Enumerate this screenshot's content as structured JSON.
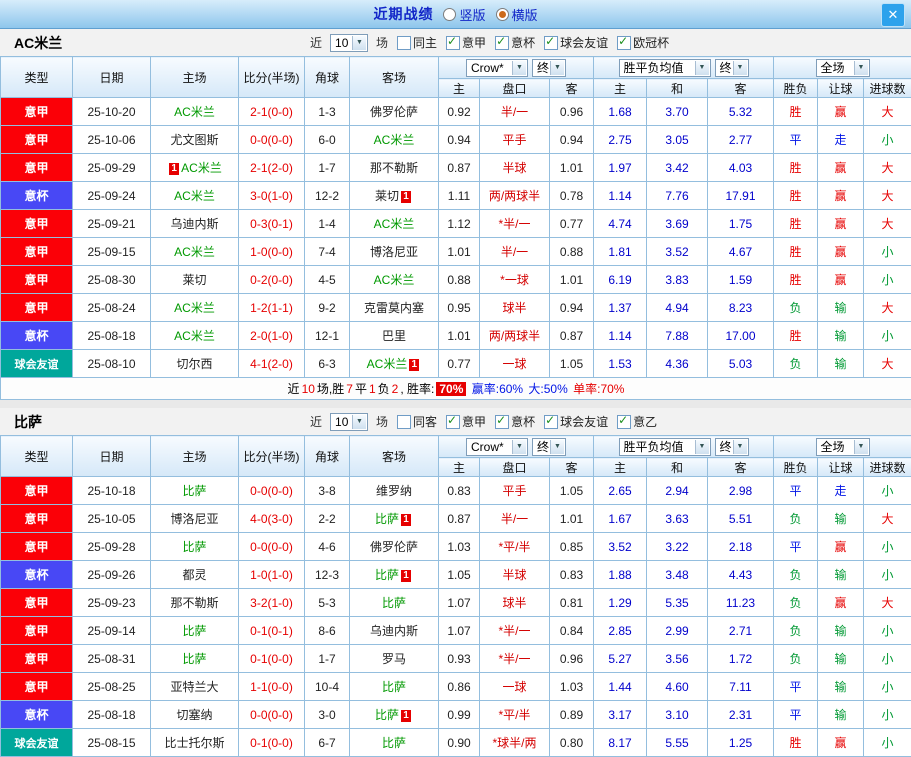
{
  "titlebar": {
    "title": "近期战绩",
    "vertical": "竖版",
    "horizontal": "横版",
    "close": "✕"
  },
  "sections": [
    {
      "team": "AC米兰",
      "filters": {
        "near": "近",
        "count": "10",
        "games": "场",
        "checkboxes": [
          {
            "label": "同主",
            "checked": false
          },
          {
            "label": "意甲",
            "checked": true
          },
          {
            "label": "意杯",
            "checked": true
          },
          {
            "label": "球会友谊",
            "checked": true
          },
          {
            "label": "欧冠杯",
            "checked": true
          }
        ]
      },
      "dropdowns": {
        "company": "Crow*",
        "final1": "终",
        "avg": "胜平负均值",
        "final2": "终",
        "scope": "全场"
      },
      "columns": {
        "type": "类型",
        "date": "日期",
        "home": "主场",
        "score": "比分(半场)",
        "corners": "角球",
        "away": "客场",
        "odds_home": "主",
        "handicap": "盘口",
        "odds_away": "客",
        "avg_home": "主",
        "avg_draw": "和",
        "avg_away": "客",
        "result": "胜负",
        "let": "让球",
        "goals": "进球数"
      },
      "rows": [
        {
          "type": "意甲",
          "date": "25-10-20",
          "home": "AC米兰",
          "home_team": true,
          "score": "2-1(0-0)",
          "corners": "1-3",
          "away": "佛罗伦萨",
          "oh": "0.92",
          "hcap": "半/一",
          "oa": "0.96",
          "ah": "1.68",
          "ad": "3.70",
          "aa": "5.32",
          "res": "胜",
          "let": "赢",
          "goals": "大"
        },
        {
          "type": "意甲",
          "date": "25-10-06",
          "home": "尤文图斯",
          "away": "AC米兰",
          "away_team": true,
          "score": "0-0(0-0)",
          "corners": "6-0",
          "oh": "0.94",
          "hcap": "平手",
          "oa": "0.94",
          "ah": "2.75",
          "ad": "3.05",
          "aa": "2.77",
          "res": "平",
          "let": "走",
          "goals": "小"
        },
        {
          "type": "意甲",
          "date": "25-09-29",
          "home": "AC米兰",
          "home_team": true,
          "home_card": true,
          "score": "2-1(2-0)",
          "corners": "1-7",
          "away": "那不勒斯",
          "oh": "0.87",
          "hcap": "半球",
          "oa": "1.01",
          "ah": "1.97",
          "ad": "3.42",
          "aa": "4.03",
          "res": "胜",
          "let": "赢",
          "goals": "大"
        },
        {
          "type": "意杯",
          "date": "25-09-24",
          "home": "AC米兰",
          "home_team": true,
          "score": "3-0(1-0)",
          "corners": "12-2",
          "away": "莱切",
          "away_card": true,
          "oh": "1.11",
          "hcap": "两/两球半",
          "oa": "0.78",
          "ah": "1.14",
          "ad": "7.76",
          "aa": "17.91",
          "res": "胜",
          "let": "赢",
          "goals": "大"
        },
        {
          "type": "意甲",
          "date": "25-09-21",
          "home": "乌迪内斯",
          "away": "AC米兰",
          "away_team": true,
          "score": "0-3(0-1)",
          "corners": "1-4",
          "oh": "1.12",
          "hcap": "*半/一",
          "oa": "0.77",
          "ah": "4.74",
          "ad": "3.69",
          "aa": "1.75",
          "res": "胜",
          "let": "赢",
          "goals": "大"
        },
        {
          "type": "意甲",
          "date": "25-09-15",
          "home": "AC米兰",
          "home_team": true,
          "score": "1-0(0-0)",
          "corners": "7-4",
          "away": "博洛尼亚",
          "oh": "1.01",
          "hcap": "半/一",
          "oa": "0.88",
          "ah": "1.81",
          "ad": "3.52",
          "aa": "4.67",
          "res": "胜",
          "let": "赢",
          "goals": "小"
        },
        {
          "type": "意甲",
          "date": "25-08-30",
          "home": "莱切",
          "away": "AC米兰",
          "away_team": true,
          "score": "0-2(0-0)",
          "corners": "4-5",
          "oh": "0.88",
          "hcap": "*一球",
          "oa": "1.01",
          "ah": "6.19",
          "ad": "3.83",
          "aa": "1.59",
          "res": "胜",
          "let": "赢",
          "goals": "小"
        },
        {
          "type": "意甲",
          "date": "25-08-24",
          "home": "AC米兰",
          "home_team": true,
          "score": "1-2(1-1)",
          "corners": "9-2",
          "away": "克雷莫内塞",
          "oh": "0.95",
          "hcap": "球半",
          "oa": "0.94",
          "ah": "1.37",
          "ad": "4.94",
          "aa": "8.23",
          "res": "负",
          "let": "输",
          "goals": "大"
        },
        {
          "type": "意杯",
          "date": "25-08-18",
          "home": "AC米兰",
          "home_team": true,
          "score": "2-0(1-0)",
          "corners": "12-1",
          "away": "巴里",
          "oh": "1.01",
          "hcap": "两/两球半",
          "oa": "0.87",
          "ah": "1.14",
          "ad": "7.88",
          "aa": "17.00",
          "res": "胜",
          "let": "输",
          "goals": "小"
        },
        {
          "type": "球会友谊",
          "date": "25-08-10",
          "home": "切尔西",
          "away": "AC米兰",
          "away_team": true,
          "away_card": true,
          "score": "4-1(2-0)",
          "corners": "6-3",
          "oh": "0.77",
          "hcap": "一球",
          "oa": "1.05",
          "ah": "1.53",
          "ad": "4.36",
          "aa": "5.03",
          "res": "负",
          "let": "输",
          "goals": "大"
        }
      ],
      "summary": [
        {
          "t": "近",
          "c": "k"
        },
        {
          "t": "10",
          "c": "r"
        },
        {
          "t": "场,胜",
          "c": "k"
        },
        {
          "t": "7",
          "c": "r"
        },
        {
          "t": "平",
          "c": "k"
        },
        {
          "t": "1",
          "c": "r"
        },
        {
          "t": "负",
          "c": "k"
        },
        {
          "t": "2",
          "c": "r"
        },
        {
          "t": ", 胜率:",
          "c": "k"
        },
        {
          "t": "70%",
          "c": "badge"
        },
        {
          "t": " 赢率:60%",
          "c": "b"
        },
        {
          "t": " 大:50%",
          "c": "b"
        },
        {
          "t": " 单率:70%",
          "c": "r"
        }
      ]
    },
    {
      "team": "比萨",
      "filters": {
        "near": "近",
        "count": "10",
        "games": "场",
        "checkboxes": [
          {
            "label": "同客",
            "checked": false
          },
          {
            "label": "意甲",
            "checked": true
          },
          {
            "label": "意杯",
            "checked": true
          },
          {
            "label": "球会友谊",
            "checked": true
          },
          {
            "label": "意乙",
            "checked": true
          }
        ]
      },
      "dropdowns": {
        "company": "Crow*",
        "final1": "终",
        "avg": "胜平负均值",
        "final2": "终",
        "scope": "全场"
      },
      "columns": {
        "type": "类型",
        "date": "日期",
        "home": "主场",
        "score": "比分(半场)",
        "corners": "角球",
        "away": "客场",
        "odds_home": "主",
        "handicap": "盘口",
        "odds_away": "客",
        "avg_home": "主",
        "avg_draw": "和",
        "avg_away": "客",
        "result": "胜负",
        "let": "让球",
        "goals": "进球数"
      },
      "rows": [
        {
          "type": "意甲",
          "date": "25-10-18",
          "home": "比萨",
          "home_team": true,
          "score": "0-0(0-0)",
          "corners": "3-8",
          "away": "维罗纳",
          "oh": "0.83",
          "hcap": "平手",
          "oa": "1.05",
          "ah": "2.65",
          "ad": "2.94",
          "aa": "2.98",
          "res": "平",
          "let": "走",
          "goals": "小"
        },
        {
          "type": "意甲",
          "date": "25-10-05",
          "home": "博洛尼亚",
          "away": "比萨",
          "away_team": true,
          "away_card": true,
          "score": "4-0(3-0)",
          "corners": "2-2",
          "oh": "0.87",
          "hcap": "半/一",
          "oa": "1.01",
          "ah": "1.67",
          "ad": "3.63",
          "aa": "5.51",
          "res": "负",
          "let": "输",
          "goals": "大"
        },
        {
          "type": "意甲",
          "date": "25-09-28",
          "home": "比萨",
          "home_team": true,
          "score": "0-0(0-0)",
          "corners": "4-6",
          "away": "佛罗伦萨",
          "oh": "1.03",
          "hcap": "*平/半",
          "oa": "0.85",
          "ah": "3.52",
          "ad": "3.22",
          "aa": "2.18",
          "res": "平",
          "let": "赢",
          "goals": "小"
        },
        {
          "type": "意杯",
          "date": "25-09-26",
          "home": "都灵",
          "away": "比萨",
          "away_team": true,
          "away_card": true,
          "score": "1-0(1-0)",
          "corners": "12-3",
          "oh": "1.05",
          "hcap": "半球",
          "oa": "0.83",
          "ah": "1.88",
          "ad": "3.48",
          "aa": "4.43",
          "res": "负",
          "let": "输",
          "goals": "小"
        },
        {
          "type": "意甲",
          "date": "25-09-23",
          "home": "那不勒斯",
          "away": "比萨",
          "away_team": true,
          "score": "3-2(1-0)",
          "corners": "5-3",
          "oh": "1.07",
          "hcap": "球半",
          "oa": "0.81",
          "ah": "1.29",
          "ad": "5.35",
          "aa": "11.23",
          "res": "负",
          "let": "赢",
          "goals": "大"
        },
        {
          "type": "意甲",
          "date": "25-09-14",
          "home": "比萨",
          "home_team": true,
          "score": "0-1(0-1)",
          "corners": "8-6",
          "away": "乌迪内斯",
          "oh": "1.07",
          "hcap": "*半/一",
          "oa": "0.84",
          "ah": "2.85",
          "ad": "2.99",
          "aa": "2.71",
          "res": "负",
          "let": "输",
          "goals": "小"
        },
        {
          "type": "意甲",
          "date": "25-08-31",
          "home": "比萨",
          "home_team": true,
          "score": "0-1(0-0)",
          "corners": "1-7",
          "away": "罗马",
          "oh": "0.93",
          "hcap": "*半/一",
          "oa": "0.96",
          "ah": "5.27",
          "ad": "3.56",
          "aa": "1.72",
          "res": "负",
          "let": "输",
          "goals": "小"
        },
        {
          "type": "意甲",
          "date": "25-08-25",
          "home": "亚特兰大",
          "away": "比萨",
          "away_team": true,
          "score": "1-1(0-0)",
          "corners": "10-4",
          "oh": "0.86",
          "hcap": "一球",
          "oa": "1.03",
          "ah": "1.44",
          "ad": "4.60",
          "aa": "7.11",
          "res": "平",
          "let": "输",
          "goals": "小"
        },
        {
          "type": "意杯",
          "date": "25-08-18",
          "home": "切塞纳",
          "away": "比萨",
          "away_team": true,
          "away_card": true,
          "score": "0-0(0-0)",
          "corners": "3-0",
          "oh": "0.99",
          "hcap": "*平/半",
          "oa": "0.89",
          "ah": "3.17",
          "ad": "3.10",
          "aa": "2.31",
          "res": "平",
          "let": "输",
          "goals": "小"
        },
        {
          "type": "球会友谊",
          "date": "25-08-15",
          "home": "比士托尔斯",
          "away": "比萨",
          "away_team": true,
          "score": "0-1(0-0)",
          "corners": "6-7",
          "oh": "0.90",
          "hcap": "*球半/两",
          "oa": "0.80",
          "ah": "8.17",
          "ad": "5.55",
          "aa": "1.25",
          "res": "胜",
          "let": "赢",
          "goals": "小"
        }
      ]
    }
  ]
}
